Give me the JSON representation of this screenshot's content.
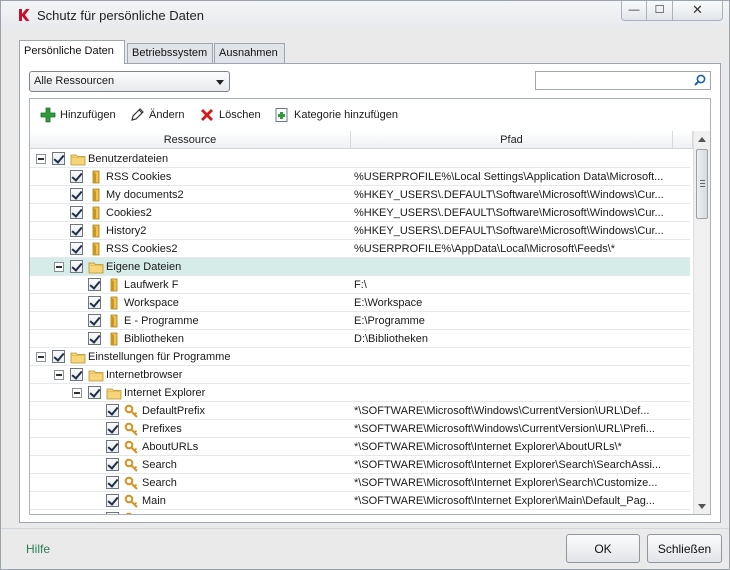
{
  "window": {
    "title": "Schutz für persönliche Daten",
    "controls": {
      "minimize": "—",
      "maximize": "☐",
      "close": "✕"
    },
    "brand_color": "#c8102e"
  },
  "tabs": [
    {
      "label": "Persönliche Daten",
      "active": true
    },
    {
      "label": "Betriebssystem",
      "active": false
    },
    {
      "label": "Ausnahmen",
      "active": false
    }
  ],
  "filter": {
    "selected": "Alle Ressourcen"
  },
  "search": {
    "placeholder": "",
    "value": ""
  },
  "toolbar": {
    "add": "Hinzufügen",
    "edit": "Ändern",
    "delete": "Löschen",
    "add_category": "Kategorie hinzufügen"
  },
  "columns": {
    "resource": "Ressource",
    "path": "Pfad"
  },
  "rows": [
    {
      "level": 0,
      "type": "folder",
      "expandable": true,
      "checked": true,
      "name": "Benutzerdateien",
      "path": ""
    },
    {
      "level": 1,
      "type": "file",
      "expandable": false,
      "checked": true,
      "name": "RSS Cookies",
      "path": "%USERPROFILE%\\Local Settings\\Application Data\\Microsoft..."
    },
    {
      "level": 1,
      "type": "file",
      "expandable": false,
      "checked": true,
      "name": "My documents2",
      "path": "%HKEY_USERS\\.DEFAULT\\Software\\Microsoft\\Windows\\Cur..."
    },
    {
      "level": 1,
      "type": "file",
      "expandable": false,
      "checked": true,
      "name": "Cookies2",
      "path": "%HKEY_USERS\\.DEFAULT\\Software\\Microsoft\\Windows\\Cur..."
    },
    {
      "level": 1,
      "type": "file",
      "expandable": false,
      "checked": true,
      "name": "History2",
      "path": "%HKEY_USERS\\.DEFAULT\\Software\\Microsoft\\Windows\\Cur..."
    },
    {
      "level": 1,
      "type": "file",
      "expandable": false,
      "checked": true,
      "name": "RSS Cookies2",
      "path": "%USERPROFILE%\\AppData\\Local\\Microsoft\\Feeds\\*"
    },
    {
      "level": 1,
      "type": "folder",
      "expandable": true,
      "checked": true,
      "name": "Eigene Dateien",
      "path": "",
      "selected": true
    },
    {
      "level": 2,
      "type": "file",
      "expandable": false,
      "checked": true,
      "name": "Laufwerk F",
      "path": "F:\\"
    },
    {
      "level": 2,
      "type": "file",
      "expandable": false,
      "checked": true,
      "name": "Workspace",
      "path": "E:\\Workspace"
    },
    {
      "level": 2,
      "type": "file",
      "expandable": false,
      "checked": true,
      "name": "E - Programme",
      "path": "E:\\Programme"
    },
    {
      "level": 2,
      "type": "file",
      "expandable": false,
      "checked": true,
      "name": "Bibliotheken",
      "path": "D:\\Bibliotheken"
    },
    {
      "level": 0,
      "type": "folder",
      "expandable": true,
      "checked": true,
      "name": "Einstellungen für Programme",
      "path": ""
    },
    {
      "level": 1,
      "type": "folder",
      "expandable": true,
      "checked": true,
      "name": "Internetbrowser",
      "path": ""
    },
    {
      "level": 2,
      "type": "folder",
      "expandable": true,
      "checked": true,
      "name": "Internet Explorer",
      "path": ""
    },
    {
      "level": 3,
      "type": "key",
      "expandable": false,
      "checked": true,
      "name": "DefaultPrefix",
      "path": "*\\SOFTWARE\\Microsoft\\Windows\\CurrentVersion\\URL\\Def..."
    },
    {
      "level": 3,
      "type": "key",
      "expandable": false,
      "checked": true,
      "name": "Prefixes",
      "path": "*\\SOFTWARE\\Microsoft\\Windows\\CurrentVersion\\URL\\Prefi..."
    },
    {
      "level": 3,
      "type": "key",
      "expandable": false,
      "checked": true,
      "name": "AboutURLs",
      "path": "*\\SOFTWARE\\Microsoft\\Internet Explorer\\AboutURLs\\*"
    },
    {
      "level": 3,
      "type": "key",
      "expandable": false,
      "checked": true,
      "name": "Search",
      "path": "*\\SOFTWARE\\Microsoft\\Internet Explorer\\Search\\SearchAssi..."
    },
    {
      "level": 3,
      "type": "key",
      "expandable": false,
      "checked": true,
      "name": "Search",
      "path": "*\\SOFTWARE\\Microsoft\\Internet Explorer\\Search\\Customize..."
    },
    {
      "level": 3,
      "type": "key",
      "expandable": false,
      "checked": true,
      "name": "Main",
      "path": "*\\SOFTWARE\\Microsoft\\Internet Explorer\\Main\\Default_Pag..."
    },
    {
      "level": 3,
      "type": "key",
      "expandable": false,
      "checked": true,
      "name": "",
      "path": ""
    }
  ],
  "footer": {
    "help": "Hilfe",
    "ok": "OK",
    "close": "Schließen"
  },
  "colors": {
    "selected_row": "#d6ece8",
    "help_link": "#2a7f52",
    "add_icon": "#2e9d3a",
    "delete_icon": "#d11a1a"
  }
}
